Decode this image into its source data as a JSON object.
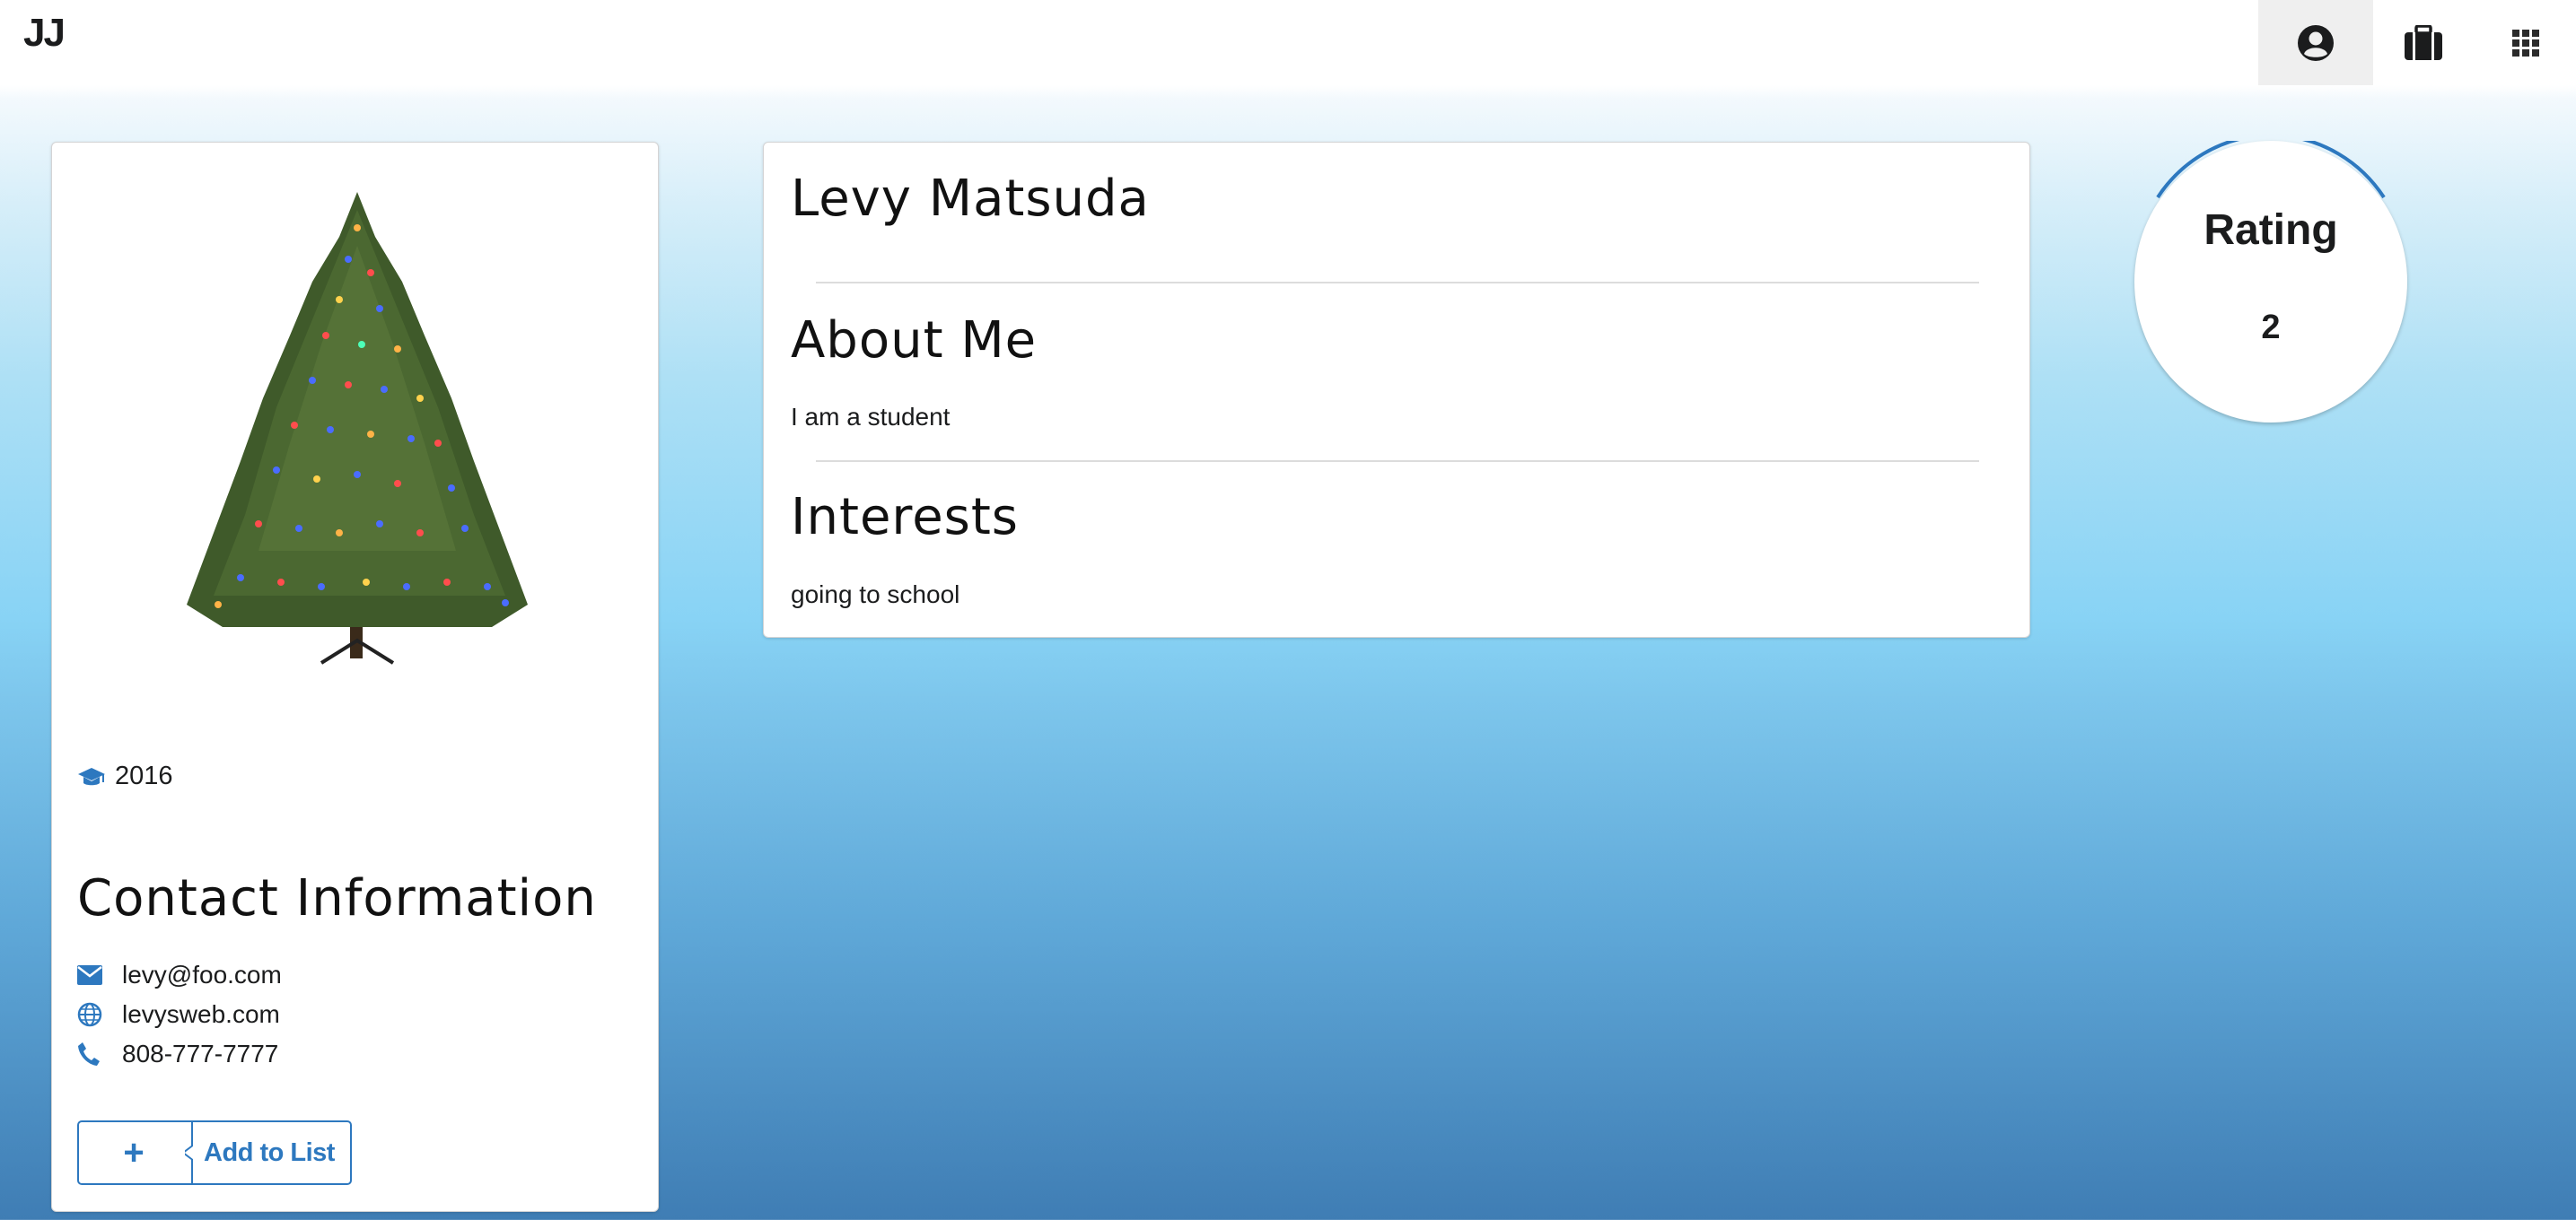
{
  "header": {
    "brand": "JJ",
    "nav": [
      {
        "icon": "user-circle-icon",
        "active": true
      },
      {
        "icon": "briefcase-icon",
        "active": false
      },
      {
        "icon": "grid-icon",
        "active": false
      }
    ]
  },
  "profile_card": {
    "image_icon": "christmas-tree-image",
    "graduation_icon": "graduation-cap-icon",
    "graduation_year": "2016",
    "contact_title": "Contact Information",
    "email": "levy@foo.com",
    "website": "levysweb.com",
    "phone": "808-777-7777",
    "add_plus": "+",
    "add_label": "Add to List"
  },
  "main": {
    "name": "Levy Matsuda",
    "about_title": "About Me",
    "about_text": "I am a student",
    "interests_title": "Interests",
    "interests_text": "going to school"
  },
  "rating": {
    "label": "Rating",
    "value": "2"
  },
  "colors": {
    "accent": "#2d78bf",
    "text": "#1b1c1d"
  }
}
